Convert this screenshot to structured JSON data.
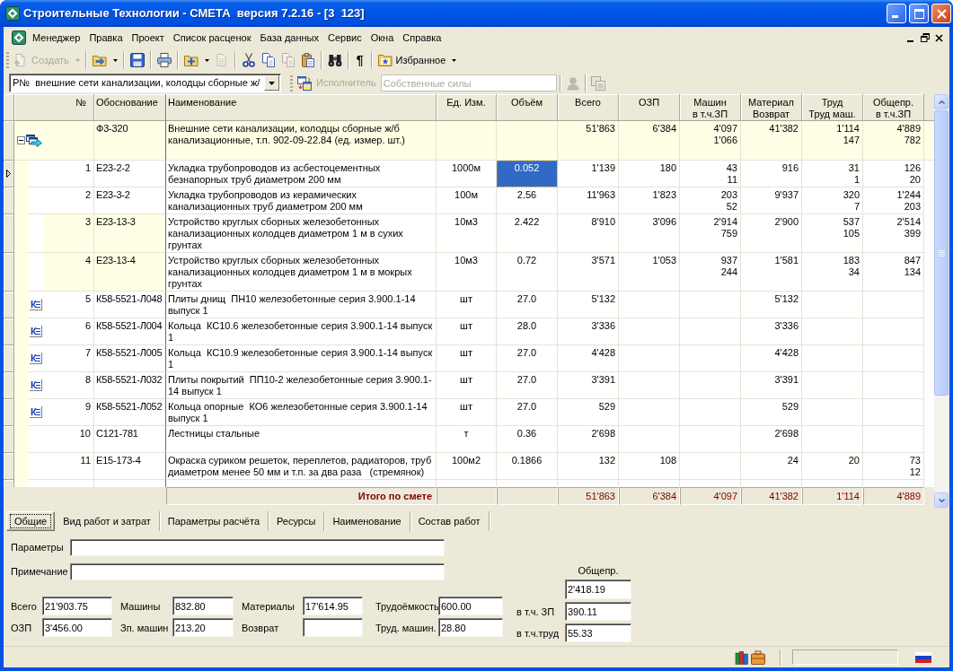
{
  "window": {
    "title": "Строительные Технологии - СМЕТА  версия 7.2.16 - [3  123]"
  },
  "menu": [
    "Менеджер",
    "Правка",
    "Проект",
    "Список расценок",
    "База данных",
    "Сервис",
    "Окна",
    "Справка"
  ],
  "toolbar": [
    {
      "kind": "new",
      "label": "Создать",
      "disabled": true,
      "dropdown": true
    },
    {
      "kind": "separator"
    },
    {
      "kind": "open",
      "disabled": false,
      "dropdown": true
    },
    {
      "kind": "separator"
    },
    {
      "kind": "save",
      "disabled": false
    },
    {
      "kind": "separator"
    },
    {
      "kind": "print",
      "disabled": false
    },
    {
      "kind": "separator"
    },
    {
      "kind": "insert",
      "disabled": false,
      "dropdown": true
    },
    {
      "kind": "export",
      "disabled": true
    },
    {
      "kind": "separator"
    },
    {
      "kind": "cut",
      "disabled": false
    },
    {
      "kind": "copy",
      "disabled": false
    },
    {
      "kind": "paste_special",
      "disabled": true
    },
    {
      "kind": "paste",
      "disabled": false
    },
    {
      "kind": "separator"
    },
    {
      "kind": "find",
      "disabled": false
    },
    {
      "kind": "separator"
    },
    {
      "kind": "formatting",
      "glyph": "¶",
      "disabled": false
    },
    {
      "kind": "separator"
    },
    {
      "kind": "favorites",
      "label": "Избранное",
      "disabled": false,
      "dropdown": true
    }
  ],
  "section_bar": {
    "section": {
      "value": "Р№  внешние сети канализации, колодцы сборные ж/"
    },
    "transfer_button": {
      "disabled": false
    },
    "executor": {
      "label": "Исполнитель",
      "value": "Собственные силы",
      "disabled": true
    },
    "contractor_button": {
      "disabled": true
    },
    "journal_button": {
      "disabled": true
    }
  },
  "estimate": {
    "columns": [
      {
        "label": "№"
      },
      {
        "label": "Обоснование"
      },
      {
        "label": "Наименование"
      },
      {
        "label": "Ед. Изм."
      },
      {
        "label": "Объём"
      },
      {
        "label": "Всего"
      },
      {
        "label": "ОЗП"
      },
      {
        "label": "Машин",
        "sublabel": "в т.ч.ЗП"
      },
      {
        "label": "Материал",
        "sublabel": "Возврат"
      },
      {
        "label": "Труд",
        "sublabel": "Труд маш."
      },
      {
        "label": "Общепр.",
        "sublabel": "в т.ч.ЗП"
      }
    ],
    "group": {
      "code": "Ф3-320",
      "name": "Внешние сети канализации, колодцы сборные ж/б канализационные, т.п. 902-09-22.84 (ед. измер. шт.)",
      "total": "51'863",
      "wages": "6'384",
      "machines": "4'097",
      "machine_wages": "1'066",
      "materials": "41'382",
      "labor": "1'114",
      "labor_machines": "147",
      "overhead": "4'889",
      "overhead_wages": "782",
      "expanded": true
    },
    "rows": [
      {
        "number": "1",
        "code": "Е23-2-2",
        "name": "Укладка трубопроводов из асбестоцементных безнапорных труб диаметром 200 мм",
        "unit": "1000м",
        "volume": "0.052",
        "total": "1'139",
        "wages": "180",
        "machines": "43",
        "machine_wages": "11",
        "materials": "916",
        "labor": "31",
        "labor_machines": "1",
        "overhead": "126",
        "overhead_wages": "20",
        "selected": true,
        "highlighted": false
      },
      {
        "number": "2",
        "code": "Е23-3-2",
        "name": "Укладка трубопроводов из керамических канализационных труб диаметром 200 мм",
        "unit": "100м",
        "volume": "2.56",
        "total": "11'963",
        "wages": "1'823",
        "machines": "203",
        "machine_wages": "52",
        "materials": "9'937",
        "labor": "320",
        "labor_machines": "7",
        "overhead": "1'244",
        "overhead_wages": "203",
        "selected": false,
        "highlighted": false
      },
      {
        "number": "3",
        "code": "Е23-13-3",
        "name": "Устройство круглых сборных железобетонных канализационных колодцев диаметром 1 м в сухих грунтах",
        "unit": "10м3",
        "volume": "2.422",
        "total": "8'910",
        "wages": "3'096",
        "machines": "2'914",
        "machine_wages": "759",
        "materials": "2'900",
        "labor": "537",
        "labor_machines": "105",
        "overhead": "2'514",
        "overhead_wages": "399",
        "selected": false,
        "highlighted": true
      },
      {
        "number": "4",
        "code": "Е23-13-4",
        "name": "Устройство круглых сборных железобетонных канализационных колодцев диаметром 1 м в мокрых грунтах",
        "unit": "10м3",
        "volume": "0.72",
        "total": "3'571",
        "wages": "1'053",
        "machines": "937",
        "machine_wages": "244",
        "materials": "1'581",
        "labor": "183",
        "labor_machines": "34",
        "overhead": "847",
        "overhead_wages": "134",
        "selected": false,
        "highlighted": true
      },
      {
        "badge": "К",
        "number": "5",
        "code": "К58-5521-Л048",
        "name": "Плиты днищ  ПН10 железобетонные серия 3.900.1-14 выпуск 1",
        "unit": "шт",
        "volume": "27.0",
        "total": "5'132",
        "materials": "5'132",
        "selected": false,
        "highlighted": false
      },
      {
        "badge": "К",
        "number": "6",
        "code": "К58-5521-Л004",
        "name": "Кольца  КС10.6 железобетонные серия 3.900.1-14 выпуск 1",
        "unit": "шт",
        "volume": "28.0",
        "total": "3'336",
        "materials": "3'336",
        "selected": false,
        "highlighted": false
      },
      {
        "badge": "К",
        "number": "7",
        "code": "К58-5521-Л005",
        "name": "Кольца  КС10.9 железобетонные серия 3.900.1-14 выпуск 1",
        "unit": "шт",
        "volume": "27.0",
        "total": "4'428",
        "materials": "4'428",
        "selected": false,
        "highlighted": false
      },
      {
        "badge": "К",
        "number": "8",
        "code": "К58-5521-Л032",
        "name": "Плиты покрытий  ПП10-2 железобетонные серия 3.900.1-14 выпуск 1",
        "unit": "шт",
        "volume": "27.0",
        "total": "3'391",
        "materials": "3'391",
        "selected": false,
        "highlighted": false
      },
      {
        "badge": "К",
        "number": "9",
        "code": "К58-5521-Л052",
        "name": "Кольца опорные  КО6 железобетонные серия 3.900.1-14 выпуск 1",
        "unit": "шт",
        "volume": "27.0",
        "total": "529",
        "materials": "529",
        "selected": false,
        "highlighted": false
      },
      {
        "number": "10",
        "code": "С121-781",
        "name": "Лестницы стальные",
        "unit": "т",
        "volume": "0.36",
        "total": "2'698",
        "materials": "2'698",
        "selected": false,
        "highlighted": false
      },
      {
        "number": "11",
        "code": "Е15-173-4",
        "name": "Окраска суриком решеток, переплетов, радиаторов, труб диаметром менее 50 мм и т.п. за два раза   (стремянок)",
        "unit": "100м2",
        "volume": "0.1866",
        "total": "132",
        "wages": "108",
        "materials": "24",
        "labor": "20",
        "overhead": "73",
        "overhead_wages": "12",
        "selected": false,
        "highlighted": false
      }
    ],
    "totals": {
      "label": "Итого по смете",
      "total": "51'863",
      "wages": "6'384",
      "machines": "4'097",
      "materials": "41'382",
      "labor": "1'114",
      "overhead": "4'889"
    }
  },
  "tabs": [
    {
      "label": "Общие",
      "selected": true
    },
    {
      "label": "Вид работ и затрат",
      "selected": false
    },
    {
      "label": "Параметры расчёта",
      "selected": false
    },
    {
      "label": "Ресурсы",
      "selected": false
    },
    {
      "label": "Наименование",
      "selected": false
    },
    {
      "label": "Состав работ",
      "selected": false
    }
  ],
  "details": {
    "parameters": {
      "label": "Параметры"
    },
    "note": {
      "label": "Примечание"
    },
    "costs": [
      {
        "label": "Всего",
        "value": "21'903.75"
      },
      {
        "label": "ОЗП",
        "value": "3'456.00"
      },
      {
        "label": "Машины",
        "value": "832.80"
      },
      {
        "label": "Зп. машин",
        "value": "213.20"
      },
      {
        "label": "Материалы",
        "value": "17'614.95"
      },
      {
        "label": "Возврат"
      },
      {
        "label": "Трудоёмкость",
        "value": "600.00"
      },
      {
        "label": "Труд. машин.",
        "value": "28.80"
      }
    ],
    "overhead": {
      "label": "Общепр.",
      "value": "2'418.19"
    },
    "overhead_parts": [
      {
        "label": "в т.ч. ЗП",
        "value": "390.11"
      },
      {
        "label": "в т.ч.труд",
        "value": "55.33"
      }
    ]
  }
}
